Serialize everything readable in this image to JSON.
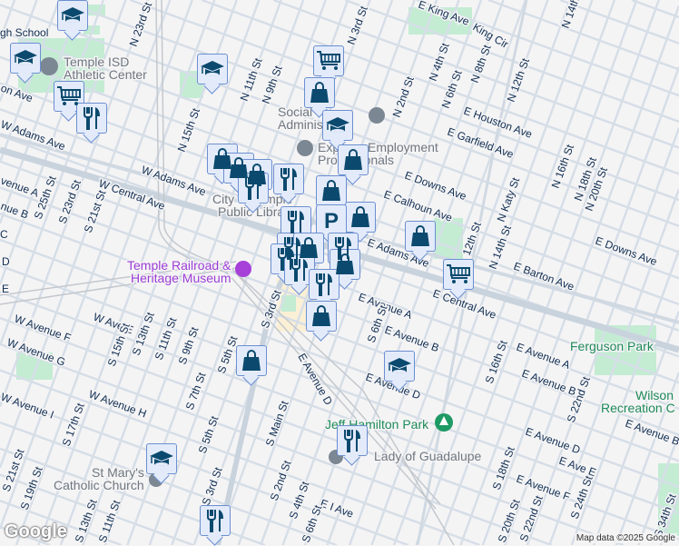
{
  "map": {
    "street_labels": [
      "gh School",
      "N 23rd St",
      "N 11th St",
      "N 9th St",
      "N 15th St",
      "on Ave",
      "W Adams Ave",
      "W Adams Ave",
      "W Central Ave",
      "venue A",
      "nue B",
      "C",
      "D",
      "E",
      "S 25th St",
      "S 23rd St",
      "S 21st St",
      "N 3rd St",
      "N 2nd St",
      "N 4th St",
      "N 6th St",
      "N 8th St",
      "N 12th St",
      "N 14th St",
      "E King Ave",
      "King Cir",
      "E Houston Ave",
      "E Garfield Ave",
      "E Downs Ave",
      "E Calhoun Ave",
      "E Adams Ave",
      "N Katy St",
      "N 16th St",
      "N 18th St",
      "N 20th St",
      "E Downs Ave",
      "N 14th St",
      "E Barton Ave",
      "E Central Ave",
      "E Avenue A",
      "S 6th St",
      "E Avenue B",
      "E Avenue D",
      "S 16th St",
      "E Avenue A",
      "E Avenue B",
      "S 22nd St",
      "E Avenue B",
      "E Avenue D",
      "E Ave E",
      "S 18th St",
      "E Avenue F",
      "S 24th St",
      "S 20th St",
      "S 22nd St",
      "S 34th St",
      "W Ave E",
      "W Avenue F",
      "W Avenue G",
      "W Avenue I",
      "W Avenue H",
      "S 15th St",
      "S 13th St",
      "S 11th St",
      "S 9th St",
      "S 7th St",
      "S 5th St",
      "S 3rd St",
      "E Avenue D",
      "S 17th St",
      "S 5th St",
      "S Main St",
      "S 21st St",
      "S 19th St",
      "S 3rd St",
      "S 2nd St",
      "S 4th St",
      "E I Ave",
      "S 13th St",
      "S 11th St",
      "S 6th St",
      "12th St"
    ],
    "poi_labels": {
      "athletic_center": [
        "Temple ISD",
        "Athletic Center"
      ],
      "social_security": [
        "Social",
        "Adminis"
      ],
      "employment": [
        "Exp",
        "Employment",
        "Professionals"
      ],
      "library": [
        "City of Temple",
        "Public Library"
      ],
      "museum": [
        "Temple Railroad &",
        "Heritage Museum"
      ],
      "ferguson_park": "Ferguson Park",
      "wilson": [
        "Wilson",
        "Recreation C"
      ],
      "jeff_hamilton": "Jeff Hamilton Park",
      "guadalupe": "Lady of Guadalupe",
      "st_marys": [
        "St Mary's",
        "Catholic Church"
      ]
    },
    "markers": [
      {
        "type": "school"
      },
      {
        "type": "school"
      },
      {
        "type": "school"
      },
      {
        "type": "cart"
      },
      {
        "type": "bag"
      },
      {
        "type": "cart"
      },
      {
        "type": "restaurant"
      },
      {
        "type": "school"
      },
      {
        "type": "bag"
      },
      {
        "type": "bag"
      },
      {
        "type": "bag"
      },
      {
        "type": "bag"
      },
      {
        "type": "restaurant"
      },
      {
        "type": "restaurant"
      },
      {
        "type": "bag"
      },
      {
        "type": "bag"
      },
      {
        "type": "parking"
      },
      {
        "type": "restaurant"
      },
      {
        "type": "restaurant"
      },
      {
        "type": "bag"
      },
      {
        "type": "restaurant"
      },
      {
        "type": "restaurant"
      },
      {
        "type": "bag"
      },
      {
        "type": "restaurant"
      },
      {
        "type": "restaurant"
      },
      {
        "type": "bag"
      },
      {
        "type": "bag"
      },
      {
        "type": "cart"
      },
      {
        "type": "bag"
      },
      {
        "type": "school"
      },
      {
        "type": "restaurant"
      },
      {
        "type": "school"
      },
      {
        "type": "restaurant"
      }
    ],
    "colors": {
      "marker_icon": "#0b4a6e",
      "marker_bg": "#e3ebfb",
      "road": "#d3dce6",
      "park": "#c3ecd3"
    }
  },
  "footer": {
    "logo": "Google",
    "attribution": "Map data ©2025 Google"
  }
}
